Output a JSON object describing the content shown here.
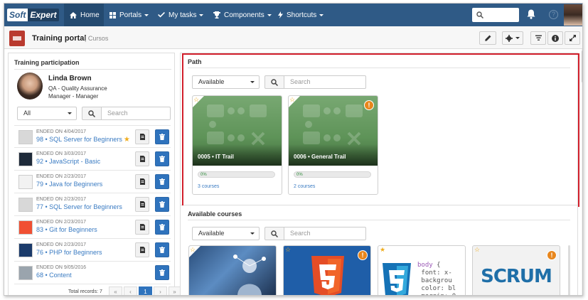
{
  "brand": {
    "part1": "Soft",
    "part2": "Expert"
  },
  "nav": {
    "home": "Home",
    "portals": "Portals",
    "tasks": "My tasks",
    "components": "Components",
    "shortcuts": "Shortcuts"
  },
  "header": {
    "title": "Training portal",
    "subtitle": "| Cursos"
  },
  "participation": {
    "title": "Training participation",
    "user": {
      "name": "Linda Brown",
      "department": "QA - Quality Assurance",
      "role": "Manager - Manager"
    },
    "filter": {
      "selected": "All"
    },
    "search_placeholder": "Search",
    "courses": [
      {
        "date": "ENDED ON 4/04/2017",
        "name": "98 • SQL Server for Beginners",
        "starred": true,
        "thumb": "#d8d8d8"
      },
      {
        "date": "ENDED ON 3/03/2017",
        "name": "92 • JavaScript - Basic",
        "starred": false,
        "thumb": "#1e2a3a"
      },
      {
        "date": "ENDED ON 2/23/2017",
        "name": "79 • Java for Beginners",
        "starred": false,
        "thumb": "#f2f2f2"
      },
      {
        "date": "ENDED ON 2/23/2017",
        "name": "77 • SQL Server for Beginners",
        "starred": false,
        "thumb": "#d8d8d8"
      },
      {
        "date": "ENDED ON 2/23/2017",
        "name": "83 • Git for Beginners",
        "starred": false,
        "thumb": "#f05033"
      },
      {
        "date": "ENDED ON 2/23/2017",
        "name": "76 • PHP for Beginners",
        "starred": false,
        "thumb": "#1b3b6b"
      },
      {
        "date": "ENDED ON 9/05/2016",
        "name": "68 • Content",
        "starred": false,
        "thumb": "#9aa4ad"
      }
    ],
    "pager": {
      "total": "Total records: 7",
      "first": "«",
      "prev": "‹",
      "current": "1",
      "next": "›",
      "last": "»"
    }
  },
  "path": {
    "title": "Path",
    "filter": {
      "selected": "Available"
    },
    "search_placeholder": "Search",
    "trails": [
      {
        "title": "0005 • IT Trail",
        "progress_label": "0%",
        "progress": 0,
        "courses": "3 courses",
        "warning": false
      },
      {
        "title": "0006 • General Trail",
        "progress_label": "0%",
        "progress": 0,
        "courses": "2 courses",
        "warning": true
      }
    ]
  },
  "available": {
    "title": "Available courses",
    "filter": {
      "selected": "Available"
    },
    "search_placeholder": "Search",
    "courses": [
      {
        "icon": "network-person-image",
        "warning": false
      },
      {
        "icon": "html5-image",
        "warning": true
      },
      {
        "icon": "css3-image",
        "warning": false
      },
      {
        "icon": "scrum-image",
        "warning": true,
        "label": "SCRUM"
      }
    ]
  },
  "colors": {
    "nav": "#2f5a86",
    "accent": "#2f73bd",
    "highlight": "#d21f2b",
    "trail": "#5e9358",
    "warning": "#e8861c",
    "star": "#f0ad1e"
  }
}
